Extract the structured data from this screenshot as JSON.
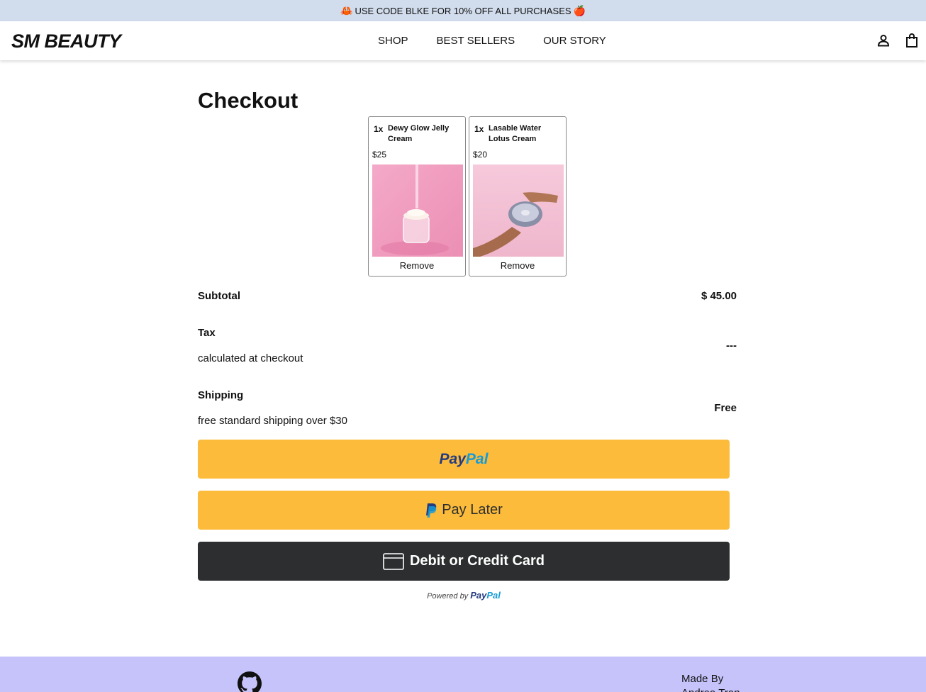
{
  "promo": {
    "text": "USE CODE BLKE FOR 10% OFF ALL PURCHASES",
    "emoji_left": "🦀",
    "emoji_right": "🍎"
  },
  "header": {
    "logo": "SM BEAUTY",
    "nav": [
      "SHOP",
      "BEST SELLERS",
      "OUR STORY"
    ],
    "icons": [
      "account-icon",
      "shopping-bag-icon"
    ]
  },
  "checkout": {
    "title": "Checkout",
    "items": [
      {
        "qty": "1x",
        "name": "Dewy Glow Jelly Cream",
        "price": "$25",
        "remove_label": "Remove"
      },
      {
        "qty": "1x",
        "name": "Lasable Water Lotus Cream",
        "price": "$20",
        "remove_label": "Remove"
      }
    ],
    "subtotal": {
      "label": "Subtotal",
      "value": "$ 45.00"
    },
    "tax": {
      "label": "Tax",
      "note": "calculated at checkout",
      "value": "---"
    },
    "shipping": {
      "label": "Shipping",
      "note": "free standard shipping over $30",
      "value": "Free"
    }
  },
  "payment": {
    "paypal": {
      "pay": "Pay",
      "pal": "Pal"
    },
    "pay_later": "Pay Later",
    "card": "Debit or Credit Card",
    "powered_by": "Powered by",
    "colors": {
      "paypal_yellow": "#fcbb3a",
      "card_dark": "#2c2e2f",
      "paypal_navy": "#253b80",
      "paypal_blue": "#179bd7"
    }
  },
  "footer": {
    "made_by_line1": "Made By",
    "made_by_line2": "Andrea Tran",
    "icon": "github-icon"
  },
  "colors": {
    "promo_bg": "#d1dcec",
    "footer_bg": "#c6c3fb"
  }
}
